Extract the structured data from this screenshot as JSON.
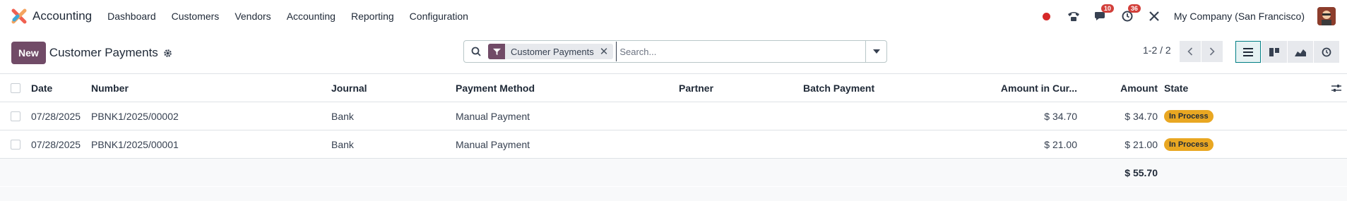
{
  "app": {
    "name": "Accounting",
    "menu": [
      "Dashboard",
      "Customers",
      "Vendors",
      "Accounting",
      "Reporting",
      "Configuration"
    ]
  },
  "systray": {
    "messages_count": "10",
    "activities_count": "36",
    "company": "My Company (San Francisco)"
  },
  "control": {
    "new_label": "New",
    "title": "Customer Payments",
    "facet_label": "Customer Payments",
    "search_placeholder": "Search...",
    "pager": "1-2 / 2"
  },
  "table": {
    "headers": {
      "date": "Date",
      "number": "Number",
      "journal": "Journal",
      "payment_method": "Payment Method",
      "partner": "Partner",
      "batch_payment": "Batch Payment",
      "amount_currency": "Amount in Cur...",
      "amount": "Amount",
      "state": "State"
    },
    "rows": [
      {
        "date": "07/28/2025",
        "number": "PBNK1/2025/00002",
        "journal": "Bank",
        "payment_method": "Manual Payment",
        "partner": "",
        "batch_payment": "",
        "amount_currency": "$ 34.70",
        "amount": "$ 34.70",
        "state": "In Process"
      },
      {
        "date": "07/28/2025",
        "number": "PBNK1/2025/00001",
        "journal": "Bank",
        "payment_method": "Manual Payment",
        "partner": "",
        "batch_payment": "",
        "amount_currency": "$ 21.00",
        "amount": "$ 21.00",
        "state": "In Process"
      }
    ],
    "total_amount": "$ 55.70"
  },
  "colors": {
    "brand": "#714b67",
    "state_in_process": "#e9a722",
    "badge": "#d23f3a",
    "active_view": "#017e84"
  },
  "icons": [
    "accounting-logo-icon",
    "record-dot-icon",
    "phone-icon",
    "chat-icon",
    "clock-icon",
    "tools-icon",
    "gear-icon",
    "search-icon",
    "filter-icon",
    "close-icon",
    "caret-down-icon",
    "chevron-left-icon",
    "chevron-right-icon",
    "list-view-icon",
    "kanban-view-icon",
    "graph-view-icon",
    "activity-view-icon",
    "optional-columns-icon"
  ]
}
